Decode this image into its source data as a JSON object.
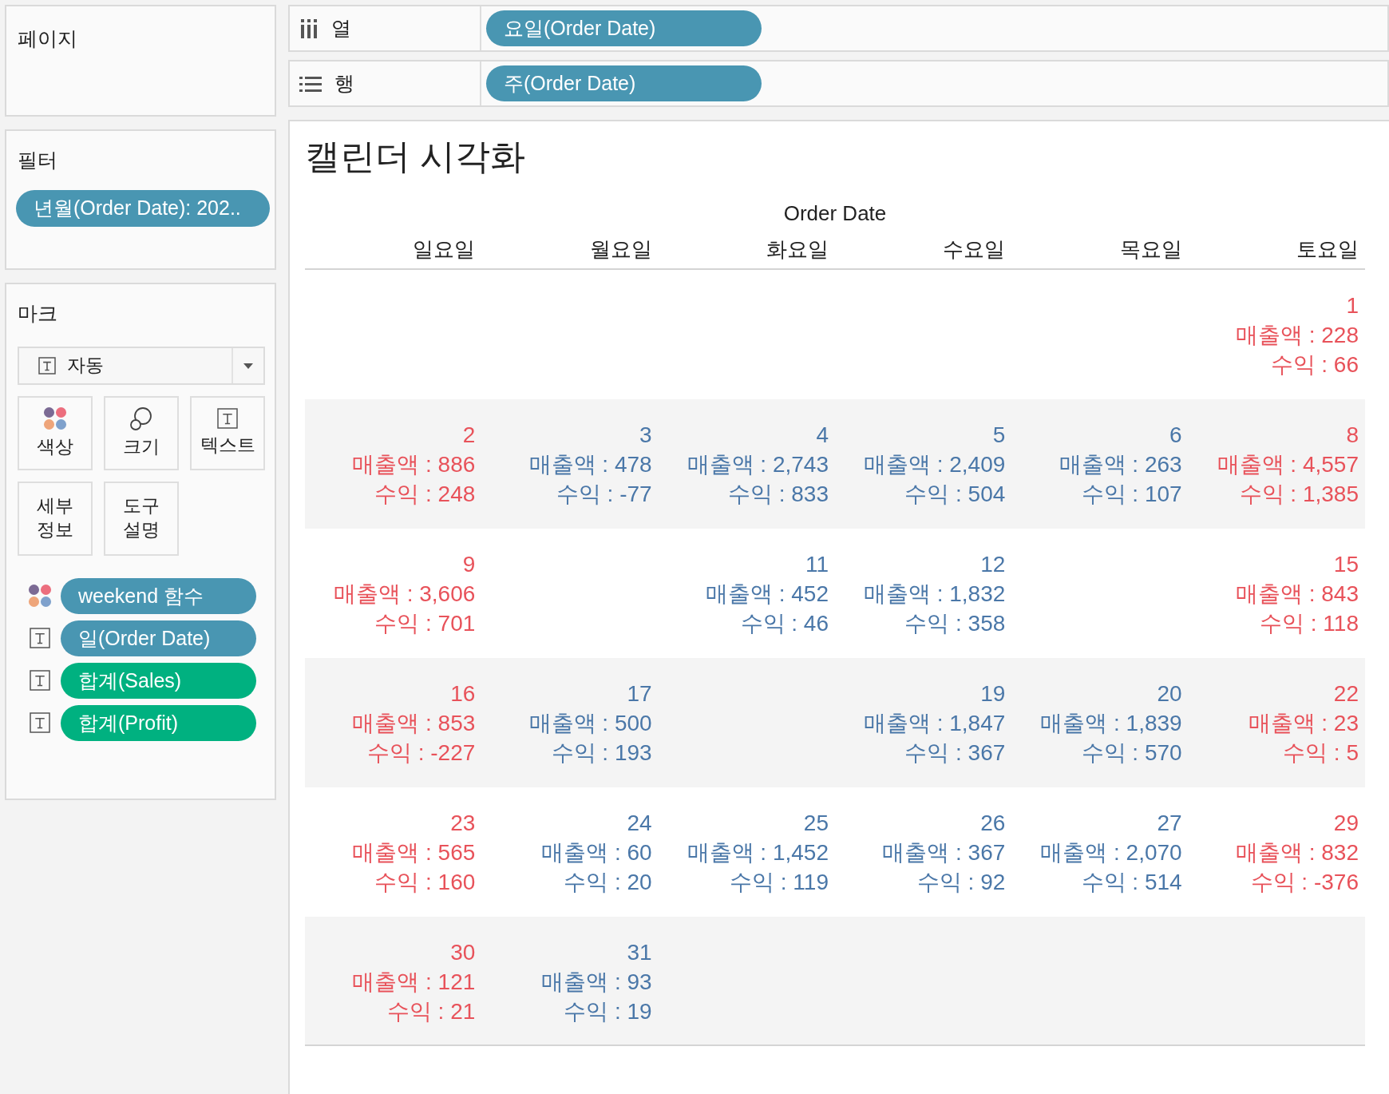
{
  "pages_card": {
    "title": "페이지"
  },
  "shelves": [
    {
      "kind": "columns",
      "label": "열",
      "pill": "요일(Order Date)"
    },
    {
      "kind": "rows",
      "label": "행",
      "pill": "주(Order Date)"
    }
  ],
  "filters_card": {
    "title": "필터",
    "pill": "년월(Order Date): 202.."
  },
  "marks_card": {
    "title": "마크",
    "mark_type": "자동",
    "buttons": [
      {
        "kind": "color",
        "lines": [
          "색상"
        ]
      },
      {
        "kind": "size",
        "lines": [
          "크기"
        ]
      },
      {
        "kind": "text",
        "lines": [
          "텍스트"
        ]
      },
      {
        "kind": "detail",
        "lines": [
          "세부",
          "정보"
        ]
      },
      {
        "kind": "tooltip",
        "lines": [
          "도구",
          "설명"
        ]
      }
    ],
    "fields": [
      {
        "kind": "color",
        "label": "weekend 함수",
        "color": "#4996b2"
      },
      {
        "kind": "text",
        "label": "일(Order Date)",
        "color": "#4996b2"
      },
      {
        "kind": "text",
        "label": "합계(Sales)",
        "color": "#00b180"
      },
      {
        "kind": "text",
        "label": "합계(Profit)",
        "color": "#00b180"
      }
    ]
  },
  "view": {
    "title": "캘린더 시각화",
    "column_header": "Order Date",
    "columns": [
      "일요일",
      "월요일",
      "화요일",
      "수요일",
      "목요일",
      "토요일"
    ],
    "weeks": [
      {
        "cells": [
          null,
          null,
          null,
          null,
          null,
          {
            "day": "1",
            "sales": "매출액 : 228",
            "profit": "수익 : 66",
            "color": "#e8525a"
          }
        ]
      },
      {
        "cells": [
          {
            "day": "2",
            "sales": "매출액 : 886",
            "profit": "수익 : 248",
            "color": "#e8525a"
          },
          {
            "day": "3",
            "sales": "매출액 : 478",
            "profit": "수익 : -77",
            "color": "#4a77a8"
          },
          {
            "day": "4",
            "sales": "매출액 : 2,743",
            "profit": "수익 : 833",
            "color": "#4a77a8"
          },
          {
            "day": "5",
            "sales": "매출액 : 2,409",
            "profit": "수익 : 504",
            "color": "#4a77a8"
          },
          {
            "day": "6",
            "sales": "매출액 : 263",
            "profit": "수익 : 107",
            "color": "#4a77a8"
          },
          {
            "day": "8",
            "sales": "매출액 : 4,557",
            "profit": "수익 : 1,385",
            "color": "#e8525a"
          }
        ]
      },
      {
        "cells": [
          {
            "day": "9",
            "sales": "매출액 : 3,606",
            "profit": "수익 : 701",
            "color": "#e8525a"
          },
          null,
          {
            "day": "11",
            "sales": "매출액 : 452",
            "profit": "수익 : 46",
            "color": "#4a77a8"
          },
          {
            "day": "12",
            "sales": "매출액 : 1,832",
            "profit": "수익 : 358",
            "color": "#4a77a8"
          },
          null,
          {
            "day": "15",
            "sales": "매출액 : 843",
            "profit": "수익 : 118",
            "color": "#e8525a"
          }
        ]
      },
      {
        "cells": [
          {
            "day": "16",
            "sales": "매출액 : 853",
            "profit": "수익 : -227",
            "color": "#e8525a"
          },
          {
            "day": "17",
            "sales": "매출액 : 500",
            "profit": "수익 : 193",
            "color": "#4a77a8"
          },
          null,
          {
            "day": "19",
            "sales": "매출액 : 1,847",
            "profit": "수익 : 367",
            "color": "#4a77a8"
          },
          {
            "day": "20",
            "sales": "매출액 : 1,839",
            "profit": "수익 : 570",
            "color": "#4a77a8"
          },
          {
            "day": "22",
            "sales": "매출액 : 23",
            "profit": "수익 : 5",
            "color": "#e8525a"
          }
        ]
      },
      {
        "cells": [
          {
            "day": "23",
            "sales": "매출액 : 565",
            "profit": "수익 : 160",
            "color": "#e8525a"
          },
          {
            "day": "24",
            "sales": "매출액 : 60",
            "profit": "수익 : 20",
            "color": "#4a77a8"
          },
          {
            "day": "25",
            "sales": "매출액 : 1,452",
            "profit": "수익 : 119",
            "color": "#4a77a8"
          },
          {
            "day": "26",
            "sales": "매출액 : 367",
            "profit": "수익 : 92",
            "color": "#4a77a8"
          },
          {
            "day": "27",
            "sales": "매출액 : 2,070",
            "profit": "수익 : 514",
            "color": "#4a77a8"
          },
          {
            "day": "29",
            "sales": "매출액 : 832",
            "profit": "수익 : -376",
            "color": "#e8525a"
          }
        ]
      },
      {
        "cells": [
          {
            "day": "30",
            "sales": "매출액 : 121",
            "profit": "수익 : 21",
            "color": "#e8525a"
          },
          {
            "day": "31",
            "sales": "매출액 : 93",
            "profit": "수익 : 19",
            "color": "#4a77a8"
          },
          null,
          null,
          null,
          null
        ]
      }
    ]
  }
}
